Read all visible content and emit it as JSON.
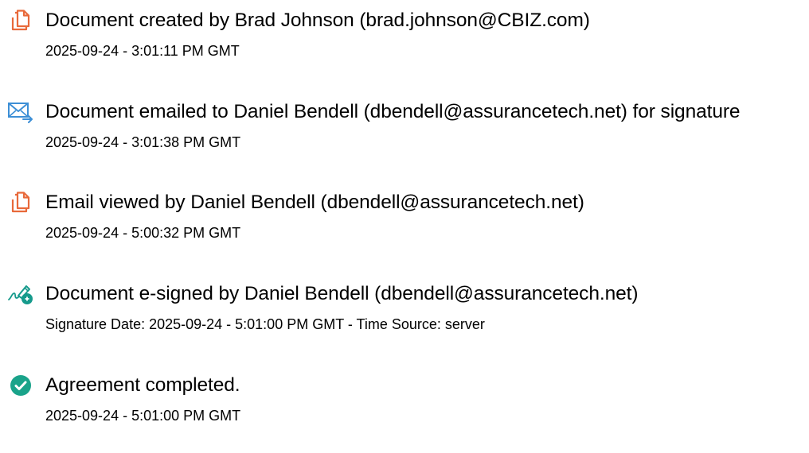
{
  "colors": {
    "document_icon": "#e8693a",
    "email_icon": "#3d8fd6",
    "signed_icon": "#169a8c",
    "completed_icon": "#1aa38a",
    "text": "#000000"
  },
  "events": [
    {
      "icon": "document-icon",
      "title": "Document created by Brad Johnson (brad.johnson@CBIZ.com)",
      "detail": "2025-09-24 - 3:01:11 PM GMT"
    },
    {
      "icon": "email-sent-icon",
      "title": "Document emailed to Daniel Bendell (dbendell@assurancetech.net) for signature",
      "detail": "2025-09-24 - 3:01:38 PM GMT"
    },
    {
      "icon": "document-icon",
      "title": "Email viewed by Daniel Bendell (dbendell@assurancetech.net)",
      "detail": "2025-09-24 - 5:00:32 PM GMT"
    },
    {
      "icon": "esign-pen-icon",
      "title": "Document e-signed by Daniel Bendell (dbendell@assurancetech.net)",
      "detail": "Signature Date: 2025-09-24 - 5:01:00 PM GMT - Time Source: server"
    },
    {
      "icon": "checkmark-circle-icon",
      "title": "Agreement completed.",
      "detail": "2025-09-24 - 5:01:00 PM GMT"
    }
  ]
}
